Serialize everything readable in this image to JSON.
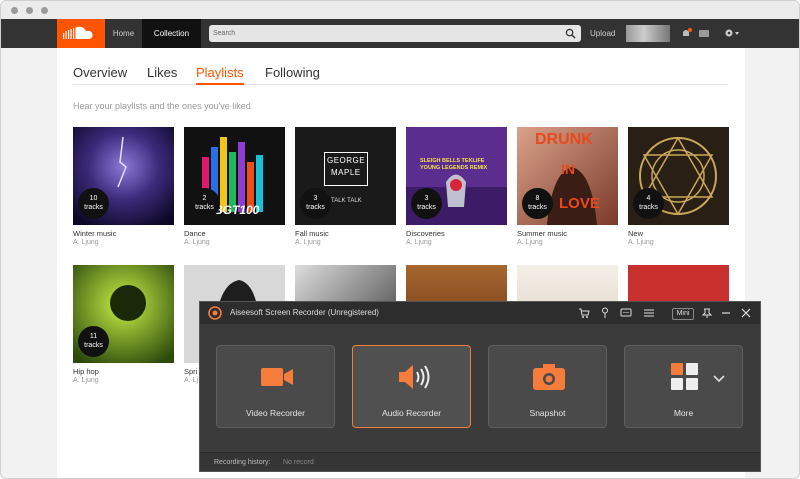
{
  "header": {
    "nav": [
      "Home",
      "Collection"
    ],
    "search_placeholder": "Search",
    "upload": "Upload"
  },
  "tabs": [
    "Overview",
    "Likes",
    "Playlists",
    "Following"
  ],
  "active_tab": "Playlists",
  "subtitle": "Hear your playlists and the ones you've liked",
  "playlists_row1": [
    {
      "title": "Winter music",
      "user": "A. Ljung",
      "count": "10",
      "unit": "tracks"
    },
    {
      "title": "Dance",
      "user": "A. Ljung",
      "count": "2",
      "unit": "tracks"
    },
    {
      "title": "Fall music",
      "user": "A. Ljung",
      "count": "3",
      "unit": "tracks"
    },
    {
      "title": "Discoveries",
      "user": "A. Ljung",
      "count": "3",
      "unit": "tracks"
    },
    {
      "title": "Summer music",
      "user": "A. Ljung",
      "count": "8",
      "unit": "tracks"
    },
    {
      "title": "New",
      "user": "A. Ljung",
      "count": "4",
      "unit": "tracks"
    }
  ],
  "playlists_row2": [
    {
      "title": "Hip hop",
      "user": "A. Ljung",
      "count": "11",
      "unit": "tracks"
    },
    {
      "title": "Spri",
      "user": "A. Lj"
    }
  ],
  "art_text": {
    "dance": "BGT100",
    "fall_line1": "GEORGE",
    "fall_line2": "MAPLE",
    "fall_line3": "TALK TALK",
    "disc_line1": "SLEIGH BELLS TEKLIFE",
    "disc_line2": "YOUNG LEGENDS REMIX",
    "summer_line1": "DRUNK",
    "summer_line2": "IN",
    "summer_line3": "LOVE"
  },
  "recorder": {
    "title": "Aiseesoft Screen Recorder (Unregistered)",
    "mini": "Mini",
    "tiles": [
      "Video Recorder",
      "Audio Recorder",
      "Snapshot",
      "More"
    ],
    "history_label": "Recording history:",
    "history_value": "No record"
  },
  "colors": {
    "accent": "#ff5500",
    "recorder_orange": "#f57c3a"
  }
}
